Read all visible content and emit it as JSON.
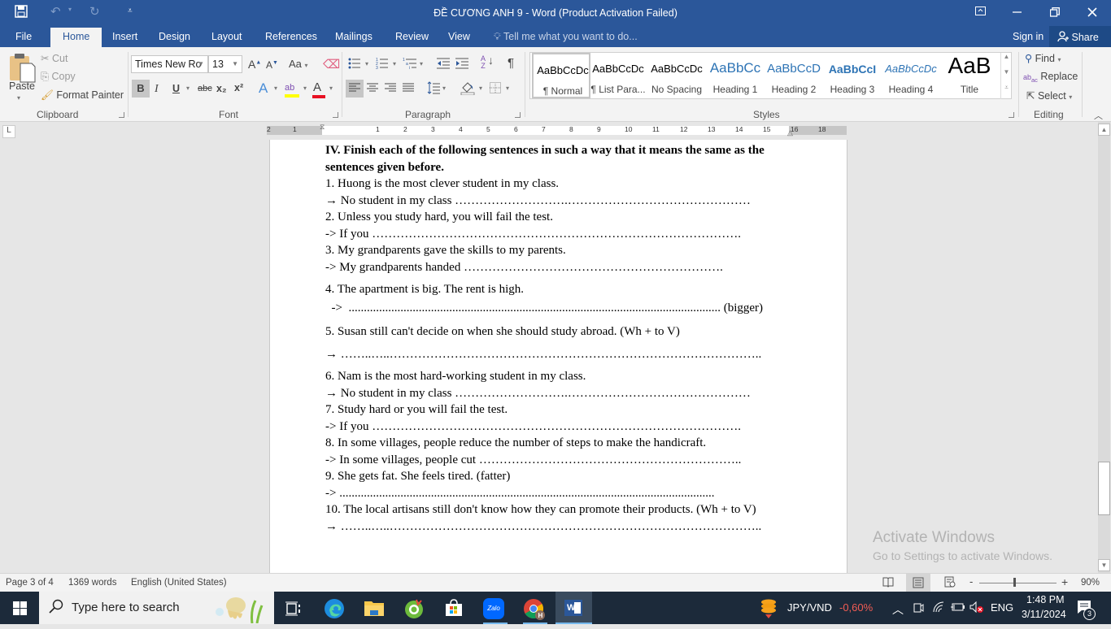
{
  "window": {
    "title": "ĐỀ CƯƠNG  ANH 9 - Word (Product Activation Failed)",
    "quick_access": {
      "save": "save-icon",
      "undo": "undo-icon",
      "redo": "redo-icon",
      "customize": "customize-icon"
    },
    "controls": {
      "ribbon_display": "▣",
      "minimize": "—",
      "restore": "❐",
      "close": "✕"
    }
  },
  "tabs": [
    {
      "label": "File"
    },
    {
      "label": "Home",
      "active": true
    },
    {
      "label": "Insert"
    },
    {
      "label": "Design"
    },
    {
      "label": "Layout"
    },
    {
      "label": "References"
    },
    {
      "label": "Mailings"
    },
    {
      "label": "Review"
    },
    {
      "label": "View"
    }
  ],
  "tell_me": "Tell me what you want to do...",
  "sign_in": "Sign in",
  "share": "Share",
  "clipboard": {
    "paste": "Paste",
    "cut": "Cut",
    "copy": "Copy",
    "format_painter": "Format Painter",
    "label": "Clipboard"
  },
  "font": {
    "name": "Times New Ro",
    "size": "13",
    "label": "Font",
    "bold": "B",
    "italic": "I",
    "underline": "U",
    "strikethrough": "abc",
    "subscript": "x₂",
    "superscript": "x²",
    "change_case": "Aa",
    "grow": "A",
    "shrink": "A",
    "highlight_color": "#ffff00",
    "font_color": "#e81123"
  },
  "paragraph": {
    "label": "Paragraph",
    "pilcrow": "¶"
  },
  "styles": {
    "label": "Styles",
    "items": [
      {
        "preview": "AaBbCcDc",
        "label": "¶ Normal",
        "color": "#000000",
        "selected": true
      },
      {
        "preview": "AaBbCcDc",
        "label": "¶ List Para...",
        "color": "#000000"
      },
      {
        "preview": "AaBbCcDc",
        "label": "No Spacing",
        "color": "#000000"
      },
      {
        "preview": "AaBbCc",
        "label": "Heading 1",
        "color": "#2e74b5"
      },
      {
        "preview": "AaBbCcD",
        "label": "Heading 2",
        "color": "#2e74b5"
      },
      {
        "preview": "AaBbCcI",
        "label": "Heading 3",
        "color": "#1f4d78"
      },
      {
        "preview": "AaBbCcDc",
        "label": "Heading 4",
        "color": "#2e74b5"
      },
      {
        "preview": "AaB",
        "label": "Title",
        "color": "#000000"
      }
    ]
  },
  "editing": {
    "label": "Editing",
    "find": "Find",
    "replace": "Replace",
    "select": "Select"
  },
  "ruler": {
    "numbers": [
      "2",
      "1",
      "1",
      "2",
      "3",
      "4",
      "5",
      "6",
      "7",
      "8",
      "9",
      "10",
      "11",
      "12",
      "13",
      "14",
      "15",
      "16",
      "18"
    ]
  },
  "document": {
    "lines": [
      {
        "text": "IV. Finish each of the following sentences in such a way that it means the same as the",
        "bold": true
      },
      {
        "text": "sentences given before.",
        "bold": true
      },
      {
        "text": "1. Huong is the most clever student in my class."
      },
      {
        "text": "→ No student in my class ……………………….………………………………………"
      },
      {
        "text": "2. Unless you study hard, you will fail the test."
      },
      {
        "text": "-> If you ………………………………………………………………………………."
      },
      {
        "text": "3.  My grandparents gave the skills to my parents."
      },
      {
        "text": "->   My grandparents handed ………………………………………………………."
      },
      {
        "text": "4. The apartment is big. The rent is high."
      },
      {
        "text": "  ->  .......................................................................................................................... (bigger)"
      },
      {
        "text": "5. Susan still can't decide on when she should study abroad. (Wh + to V)"
      },
      {
        "text": "→  ……..…..……………………………………………………………………………….."
      },
      {
        "text": "6. Nam is the most hard-working student in my class."
      },
      {
        "text": "→ No student in my class ……………………….………………………………………"
      },
      {
        "text": "7. Study hard or you will fail the test."
      },
      {
        "text": "-> If you ………………………………………………………………………………."
      },
      {
        "text": "8. In some villages, people reduce the number of steps to make the handicraft."
      },
      {
        "text": "->  In some villages, people cut ……………………………………………………….."
      },
      {
        "text": "9. She gets fat. She feels tired. (fatter)"
      },
      {
        "text": "-> ..........................................................................................................................."
      },
      {
        "text": "10. The local artisans still don't know how they can promote their products. (Wh + to V)"
      },
      {
        "text": "→  ……..…..……………………………………………………………………………….."
      }
    ]
  },
  "watermark": {
    "title": "Activate Windows",
    "subtitle": "Go to Settings to activate Windows."
  },
  "status": {
    "page": "Page 3 of 4",
    "words": "1369 words",
    "language": "English (United States)",
    "zoom": "90%",
    "zoom_minus": "-",
    "zoom_plus": "+"
  },
  "taskbar": {
    "search_placeholder": "Type here to search",
    "apps": [
      "task-view",
      "edge",
      "file-explorer",
      "coc-coc",
      "microsoft-store",
      "zalo",
      "chrome",
      "word"
    ],
    "zalo_label": "Zalo",
    "word_label": "W",
    "currency": "JPY/VND",
    "currency_change": "-0,60%",
    "currency_change_color": "#f25c54",
    "language": "ENG",
    "time": "1:48 PM",
    "date": "3/11/2024",
    "notifications": "3"
  }
}
